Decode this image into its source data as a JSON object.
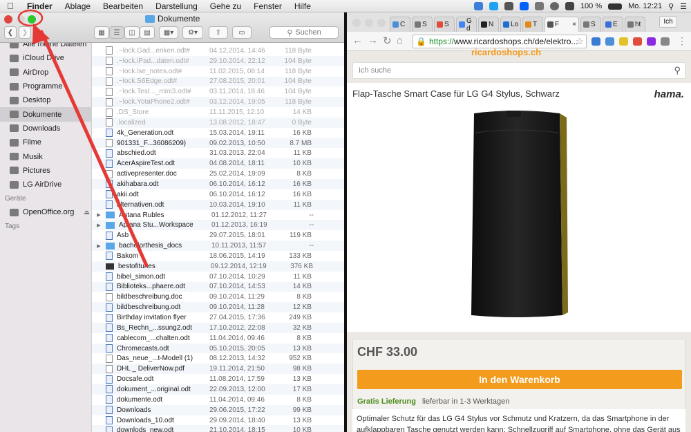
{
  "menubar": {
    "apple": "",
    "items": [
      "Finder",
      "Ablage",
      "Bearbeiten",
      "Darstellung",
      "Gehe zu",
      "Fenster",
      "Hilfe"
    ],
    "battery": "100 %",
    "clock": "Mo. 12:21"
  },
  "finder": {
    "title": "Dokumente",
    "search_label": "Suchen",
    "sidebar": {
      "items": [
        {
          "label": "Alle meine Dateien",
          "icon": "all-files-icon"
        },
        {
          "label": "iCloud Drive",
          "icon": "cloud-icon"
        },
        {
          "label": "AirDrop",
          "icon": "airdrop-icon"
        },
        {
          "label": "Programme",
          "icon": "apps-icon"
        },
        {
          "label": "Desktop",
          "icon": "desktop-icon"
        },
        {
          "label": "Dokumente",
          "icon": "documents-icon",
          "selected": true
        },
        {
          "label": "Downloads",
          "icon": "downloads-icon"
        },
        {
          "label": "Filme",
          "icon": "movies-icon"
        },
        {
          "label": "Musik",
          "icon": "music-icon"
        },
        {
          "label": "Pictures",
          "icon": "pictures-icon"
        },
        {
          "label": "LG AirDrive",
          "icon": "folder-icon"
        }
      ],
      "devices_heading": "Geräte",
      "device": "OpenOffice.org",
      "tags_heading": "Tags"
    },
    "files": [
      {
        "name": ".~lock.Gad...enken.odt#",
        "date": "04.12.2014, 14:46",
        "size": "118 Byte",
        "type": "file",
        "dim": true
      },
      {
        "name": ".~lock.iPad...daten.odt#",
        "date": "29.10.2014, 22:12",
        "size": "104 Byte",
        "type": "file",
        "dim": true
      },
      {
        "name": ".~lock.lse_notes.odt#",
        "date": "11.02.2015, 08:14",
        "size": "118 Byte",
        "type": "file",
        "dim": true
      },
      {
        "name": ".~lock.S6Edge.odt#",
        "date": "27.08.2015, 20:01",
        "size": "104 Byte",
        "type": "file",
        "dim": true
      },
      {
        "name": ".~lock.Test..._mini3.odt#",
        "date": "03.11.2014, 18:46",
        "size": "104 Byte",
        "type": "file",
        "dim": true
      },
      {
        "name": ".~lock.YotaPhone2.odt#",
        "date": "03.12.2014, 19:05",
        "size": "118 Byte",
        "type": "file",
        "dim": true
      },
      {
        "name": ".DS_Store",
        "date": "11.11.2015, 12:10",
        "size": "14 KB",
        "type": "file",
        "dim": true
      },
      {
        "name": ".localized",
        "date": "13.08.2012, 18:47",
        "size": "0 Byte",
        "type": "file",
        "dim": true
      },
      {
        "name": "4k_Generation.odt",
        "date": "15.03.2014, 19:11",
        "size": "16 KB",
        "type": "doc"
      },
      {
        "name": "901331_F...36086209)",
        "date": "09.02.2013, 10:50",
        "size": "8.7 MB",
        "type": "file"
      },
      {
        "name": "abschied.odt",
        "date": "31.03.2013, 22:04",
        "size": "11 KB",
        "type": "doc"
      },
      {
        "name": "AcerAspireTest.odt",
        "date": "04.08.2014, 18:11",
        "size": "10 KB",
        "type": "doc"
      },
      {
        "name": "activepresenter.doc",
        "date": "25.02.2014, 19:09",
        "size": "8 KB",
        "type": "file"
      },
      {
        "name": "akihabara.odt",
        "date": "06.10.2014, 16:12",
        "size": "16 KB",
        "type": "doc"
      },
      {
        "name": "akii.odt",
        "date": "06.10.2014, 16:12",
        "size": "16 KB",
        "type": "doc"
      },
      {
        "name": "alternativen.odt",
        "date": "10.03.2014, 19:10",
        "size": "11 KB",
        "type": "doc"
      },
      {
        "name": "Antana Rubles",
        "date": "01.12.2012, 11:27",
        "size": "--",
        "type": "folder"
      },
      {
        "name": "Aptana Stu...Workspace",
        "date": "01.12.2013, 16:19",
        "size": "--",
        "type": "folder"
      },
      {
        "name": "Asb",
        "date": "29.07.2015, 18:01",
        "size": "119 KB",
        "type": "doc"
      },
      {
        "name": "bachelorthesis_docs",
        "date": "10.11.2013, 11:57",
        "size": "--",
        "type": "folder"
      },
      {
        "name": "Bakom",
        "date": "18.06.2015, 14:19",
        "size": "133 KB",
        "type": "doc"
      },
      {
        "name": "bestofitunes",
        "date": "09.12.2014, 12:19",
        "size": "376 KB",
        "type": "exe"
      },
      {
        "name": "bibel_simon.odt",
        "date": "07.10.2014, 10:29",
        "size": "11 KB",
        "type": "doc"
      },
      {
        "name": "Biblioteks...phaere.odt",
        "date": "07.10.2014, 14:53",
        "size": "14 KB",
        "type": "doc"
      },
      {
        "name": "bildbeschreibung.doc",
        "date": "09.10.2014, 11:29",
        "size": "8 KB",
        "type": "file"
      },
      {
        "name": "bildbeschreibung.odt",
        "date": "09.10.2014, 11:28",
        "size": "12 KB",
        "type": "doc"
      },
      {
        "name": "Birthday invitation flyer",
        "date": "27.04.2015, 17:36",
        "size": "249 KB",
        "type": "doc"
      },
      {
        "name": "Bs_Rechn_...ssung2.odt",
        "date": "17.10.2012, 22:08",
        "size": "32 KB",
        "type": "doc"
      },
      {
        "name": "cablecom_...chalten.odt",
        "date": "11.04.2014, 09:46",
        "size": "8 KB",
        "type": "doc"
      },
      {
        "name": "Chromecasts.odt",
        "date": "05.10.2015, 20:05",
        "size": "13 KB",
        "type": "doc"
      },
      {
        "name": "Das_neue_...t-Modell (1)",
        "date": "08.12.2013, 14:32",
        "size": "952 KB",
        "type": "file"
      },
      {
        "name": "DHL _ DeliverNow.pdf",
        "date": "19.11.2014, 21:50",
        "size": "98 KB",
        "type": "file"
      },
      {
        "name": "Docsafe.odt",
        "date": "11.08.2014, 17:59",
        "size": "13 KB",
        "type": "doc"
      },
      {
        "name": "dokument_...original.odt",
        "date": "22.09.2013, 12:00",
        "size": "17 KB",
        "type": "doc"
      },
      {
        "name": "dokumente.odt",
        "date": "11.04.2014, 09:46",
        "size": "8 KB",
        "type": "doc"
      },
      {
        "name": "Downloads",
        "date": "29.06.2015, 17:22",
        "size": "99 KB",
        "type": "doc"
      },
      {
        "name": "Downloads_10.odt",
        "date": "29.09.2014, 18:40",
        "size": "13 KB",
        "type": "doc"
      },
      {
        "name": "downlods_new.odt",
        "date": "21.10.2014, 18:15",
        "size": "10 KB",
        "type": "doc"
      }
    ]
  },
  "browser": {
    "tabs": [
      {
        "label": "C",
        "color": "#4a90d9"
      },
      {
        "label": "S",
        "color": "#777"
      },
      {
        "label": "S",
        "color": "#e04b3a"
      },
      {
        "label": "G d",
        "color": "#4285f4"
      },
      {
        "label": "N",
        "color": "#222"
      },
      {
        "label": "Lo",
        "color": "#1c6fd1"
      },
      {
        "label": "T",
        "color": "#e08a1c"
      },
      {
        "label": "F",
        "color": "#555",
        "active": true
      },
      {
        "label": "S",
        "color": "#777"
      },
      {
        "label": "E",
        "color": "#3a6fd8"
      },
      {
        "label": "ht",
        "color": "#777"
      }
    ],
    "profile_label": "Ich",
    "url_https": "https://",
    "url_rest": "www.ricardoshops.ch/de/elektro...",
    "site_logo": "ricardoshops.ch",
    "search_placeholder": "Ich suche",
    "product_title": "Flap-Tasche Smart Case für LG G4 Stylus, Schwarz",
    "brand": "hama.",
    "price": "CHF 33.00",
    "cart_button": "In den Warenkorb",
    "shipping": "Gratis Lieferung",
    "delivery": "lieferbar in 1-3 Werktagen",
    "description": "Optimaler Schutz für das LG G4 Stylus vor Schmutz und Kratzern, da das Smartphone in der aufklappbaren Tasche genutzt werden kann; Schnellzugriff auf Smartphone, ohne das Gerät aus"
  },
  "colors": {
    "accent": "#f29b1c",
    "annotation": "#e53935",
    "green_light": "#2ec52e"
  }
}
